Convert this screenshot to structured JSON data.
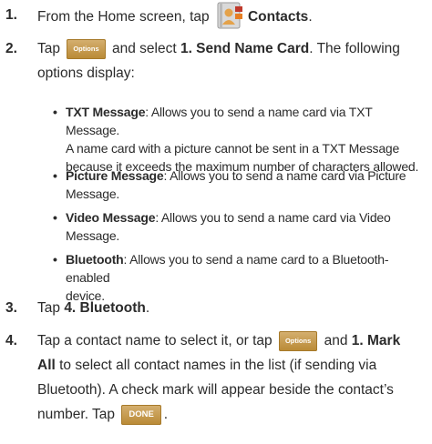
{
  "steps": [
    {
      "num": "1.",
      "pre": "From the Home screen, tap",
      "bold": "Contacts",
      "post": "."
    },
    {
      "num": "2.",
      "pre": "Tap",
      "button": "Options",
      "mid": "and select",
      "bold": "1. Send Name Card",
      "post": ". The following",
      "line2": "options display:"
    },
    {
      "num": "3.",
      "pre": "Tap",
      "bold": "4. Bluetooth",
      "post": "."
    },
    {
      "num": "4.",
      "line1_pre": "Tap a contact name to select it, or tap",
      "button": "Options",
      "line1_mid": "and",
      "line1_bold": "1. Mark",
      "line2_bold": "All",
      "line2": "to select all contact names in the list (if sending via",
      "line3": "Bluetooth). A check mark will appear beside the contact’s",
      "line4_pre": "number. Tap",
      "done_button": "DONE",
      "line4_post": "."
    }
  ],
  "bullets": [
    {
      "title": "TXT Message",
      "line1": ": Allows you to send a name card via TXT Message.",
      "line2": "A name card with a picture cannot be sent in a TXT Message",
      "line3": "because it exceeds the maximum number of characters allowed."
    },
    {
      "title": "Picture Message",
      "line1": ": Allows you to send a name card via Picture",
      "line2": "Message."
    },
    {
      "title": "Video Message",
      "line1": ": Allows you to send a name card via Video",
      "line2": "Message."
    },
    {
      "title": "Bluetooth",
      "line1": ": Allows you to send a name card to a Bluetooth-enabled",
      "line2": "device."
    }
  ],
  "icons": {
    "contacts": "contacts-book-icon",
    "bullet": "•"
  },
  "colors": {
    "button": "#c49a4c",
    "text": "#2b2b2b"
  }
}
